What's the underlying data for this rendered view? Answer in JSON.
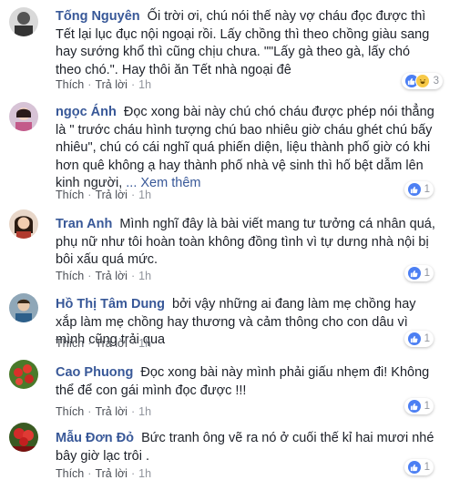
{
  "comments": [
    {
      "name": "Tống Nguyên",
      "text": "Ối trời ơi, chú nói thế này vợ cháu đọc được thì Tết lại lục đục nội ngoại rồi. Lấy chồng thì theo chồng giàu sang hay sướng khổ thì cũng chịu chưa. \"\"Lấy gà theo gà, lấy chó theo chó.\". Hay thôi ăn Tết nhà ngoại đê",
      "more": "",
      "like": "Thích",
      "reply": "Trả lời",
      "time": "1h",
      "reaction_count": "3",
      "reactions": [
        "like-icon",
        "haha-icon"
      ],
      "colors": {
        "like": "#4c7ff3",
        "haha": "#f7c948"
      }
    },
    {
      "name": "ngọc Ánh",
      "text": "Đọc xong bài này chú chó cháu được phép nói thẳng là \" trước cháu hình tượng chú bao nhiêu giờ cháu ghét chú bấy nhiêu\", chú có cái nghĩ quá phiến diện, liệu thành phố giờ có khi hơn quê không ạ hay thành phố nhà vệ sinh thì hố bệt dẫm lên kinh người,",
      "more": "... Xem thêm",
      "like": "Thích",
      "reply": "Trả lời",
      "time": "1h",
      "reaction_count": "1",
      "reactions": [
        "like-icon"
      ]
    },
    {
      "name": "Tran Anh",
      "text": "Mình nghĩ đây là bài viết mang tư tưởng cá nhân quá, phụ nữ như tôi hoàn toàn không đồng tình vì tự dưng nhà nội bị bôi xấu quá mức.",
      "more": "",
      "like": "Thích",
      "reply": "Trả lời",
      "time": "1h",
      "reaction_count": "1",
      "reactions": [
        "like-icon"
      ]
    },
    {
      "name": "Hồ Thị Tâm Dung",
      "text": "bởi vậy những ai đang làm mẹ chồng hay xắp làm mẹ chồng hay thương và cảm thông cho con dâu vì mình cũng trải qua",
      "more": "",
      "like": "Thích",
      "reply": "Trả lời",
      "time": "1h",
      "reaction_count": "1",
      "reactions": [
        "like-icon"
      ]
    },
    {
      "name": "Cao Phuong",
      "text": "Đọc xong bài này mình phải giấu nhẹm đi! Không thể để con gái mình đọc được !!!",
      "more": "",
      "like": "Thích",
      "reply": "Trả lời",
      "time": "1h",
      "reaction_count": "1",
      "reactions": [
        "like-icon"
      ]
    },
    {
      "name": "Mẫu Đơn Đỏ",
      "text": "Bức tranh ông vẽ ra nó ở cuối thế kỉ hai mươi nhé bây giờ lạc trôi .",
      "more": "",
      "like": "Thích",
      "reply": "Trả lời",
      "time": "1h",
      "reaction_count": "1",
      "reactions": [
        "like-icon"
      ]
    }
  ]
}
